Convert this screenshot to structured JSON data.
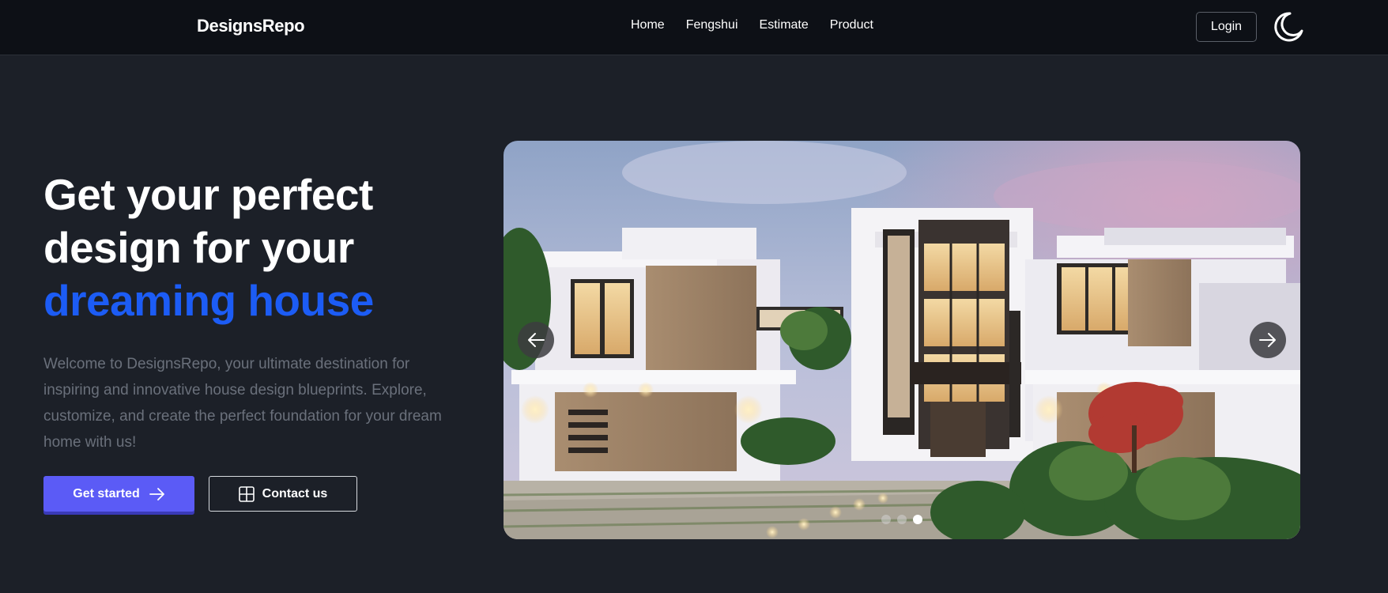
{
  "header": {
    "brand": "DesignsRepo",
    "nav": [
      "Home",
      "Fengshui",
      "Estimate",
      "Product"
    ],
    "login_label": "Login",
    "theme_icon": "moon-icon"
  },
  "hero": {
    "title_line1": "Get your perfect",
    "title_line2": "design for your",
    "title_accent": "dreaming house",
    "description": "Welcome to DesignsRepo, your ultimate destination for inspiring and innovative house design blueprints. Explore, customize, and create the perfect foundation for your dream home with us!",
    "primary_button": "Get started",
    "secondary_button": "Contact us"
  },
  "carousel": {
    "slide_count": 3,
    "active_slide": 3,
    "prev_icon": "arrow-left-icon",
    "next_icon": "arrow-right-icon"
  },
  "colors": {
    "background": "#1c2028",
    "navbar": "#0d1016",
    "accent_blue": "#1c5cf5",
    "primary_button": "#5b5bf6",
    "description_text": "#6a707b"
  }
}
